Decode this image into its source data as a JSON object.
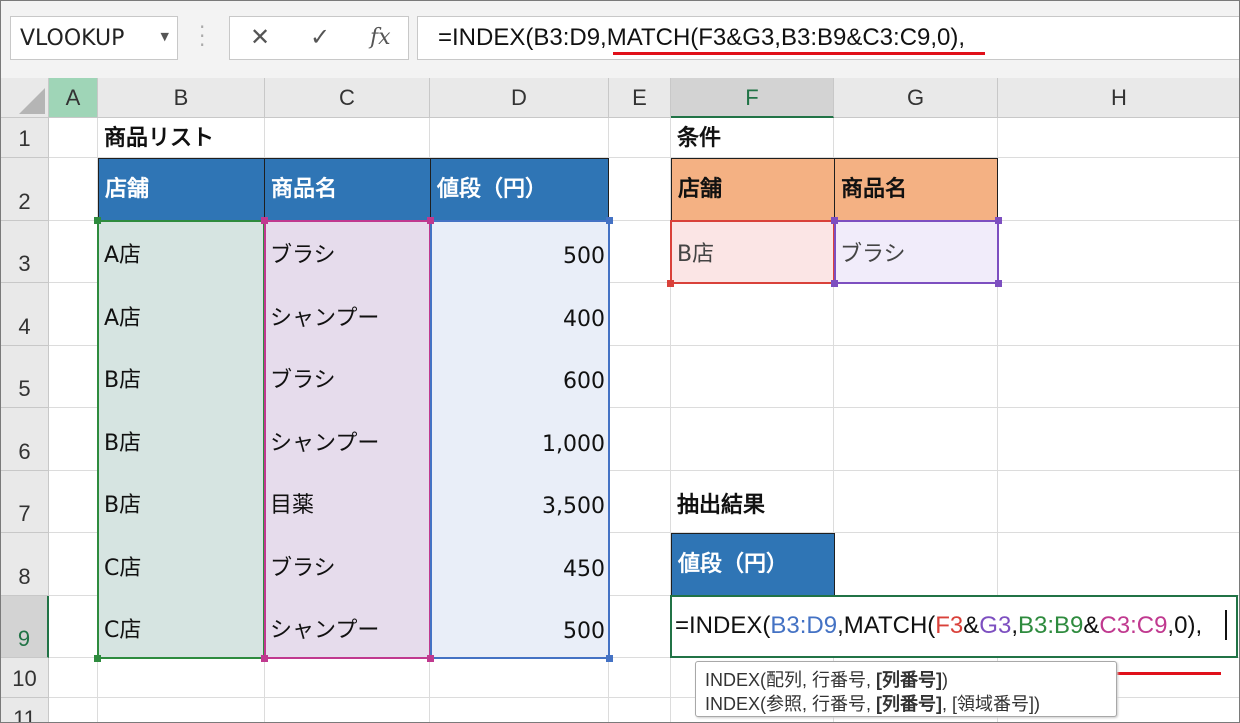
{
  "name_box": "VLOOKUP",
  "formula_buttons": {
    "cancel": "✕",
    "enter": "✓",
    "insert_function": "fx"
  },
  "formula": "=INDEX(B3:D9,MATCH(F3&G3,B3:B9&C3:C9,0),",
  "formula_parts": [
    {
      "t": "=INDEX(",
      "c": "#111111"
    },
    {
      "t": "B3:D9",
      "c": "#4472c4"
    },
    {
      "t": ",MATCH(",
      "c": "#111111"
    },
    {
      "t": "F3",
      "c": "#d9413a"
    },
    {
      "t": "&",
      "c": "#111111"
    },
    {
      "t": "G3",
      "c": "#7d4fc0"
    },
    {
      "t": ",",
      "c": "#111111"
    },
    {
      "t": "B3:B9",
      "c": "#2e8b3e"
    },
    {
      "t": "&",
      "c": "#111111"
    },
    {
      "t": "C3:C9",
      "c": "#c0398f"
    },
    {
      "t": ",0)",
      "c": "#111111"
    },
    {
      "t": ",",
      "c": "#111111"
    }
  ],
  "columns": [
    "A",
    "B",
    "C",
    "D",
    "E",
    "F",
    "G",
    "H"
  ],
  "rows": [
    "1",
    "2",
    "3",
    "4",
    "5",
    "6",
    "7",
    "8",
    "9",
    "10",
    "11"
  ],
  "product_list": {
    "title": "商品リスト",
    "headers": [
      "店舗",
      "商品名",
      "値段（円）"
    ],
    "rows": [
      [
        "A店",
        "ブラシ",
        "500"
      ],
      [
        "A店",
        "シャンプー",
        "400"
      ],
      [
        "B店",
        "ブラシ",
        "600"
      ],
      [
        "B店",
        "シャンプー",
        "1,000"
      ],
      [
        "B店",
        "目薬",
        "3,500"
      ],
      [
        "C店",
        "ブラシ",
        "450"
      ],
      [
        "C店",
        "シャンプー",
        "500"
      ]
    ]
  },
  "conditions": {
    "title": "条件",
    "headers": [
      "店舗",
      "商品名"
    ],
    "values": [
      "B店",
      "ブラシ"
    ]
  },
  "result": {
    "title": "抽出結果",
    "header": "値段（円）"
  },
  "tooltip": {
    "line1": {
      "pre": "INDEX(配列, 行番号, ",
      "bold": "[列番号]",
      "post": ")"
    },
    "line2": {
      "pre": "INDEX(参照, 行番号, ",
      "bold": "[列番号]",
      "post": ", [領域番号])"
    }
  },
  "colors": {
    "header_blue": "#2f75b5",
    "header_orange": "#f4b183",
    "excel_green": "#217346",
    "underline_red": "#e0101a"
  }
}
